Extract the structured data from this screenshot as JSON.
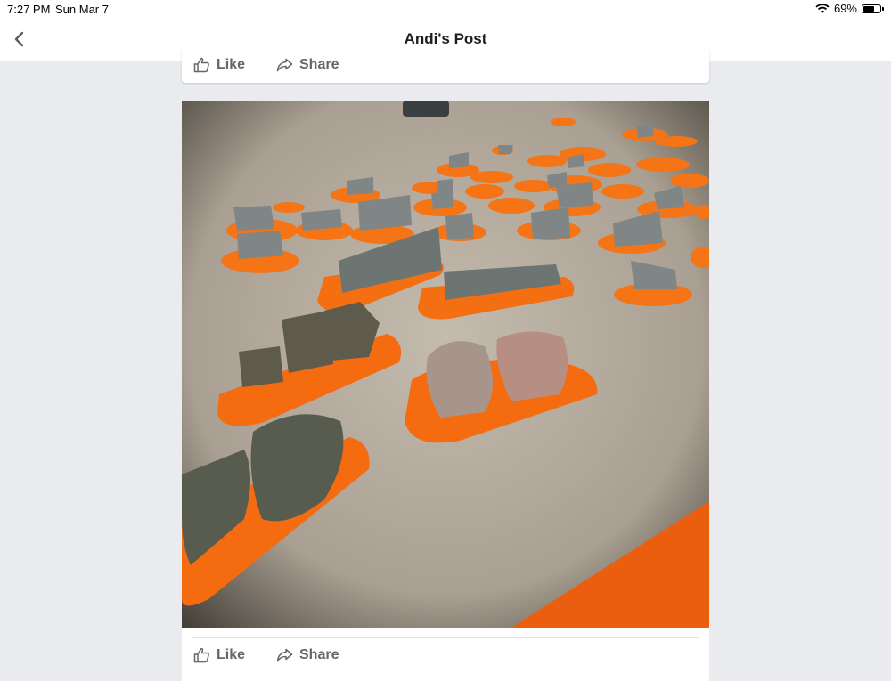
{
  "status_bar": {
    "time": "7:27 PM",
    "date": "Sun Mar 7",
    "battery_percent": "69%",
    "battery_level": 0.69
  },
  "nav": {
    "back_icon": "chevron-left-icon",
    "title": "Andi's Post"
  },
  "post_top_actions": {
    "like_label": "Like",
    "share_label": "Share"
  },
  "photo": {
    "subject": "climbing holds"
  },
  "post_bottom_actions": {
    "like_label": "Like",
    "share_label": "Share"
  },
  "colors": {
    "orange": "#f26a10",
    "text_gray": "#65676b"
  }
}
